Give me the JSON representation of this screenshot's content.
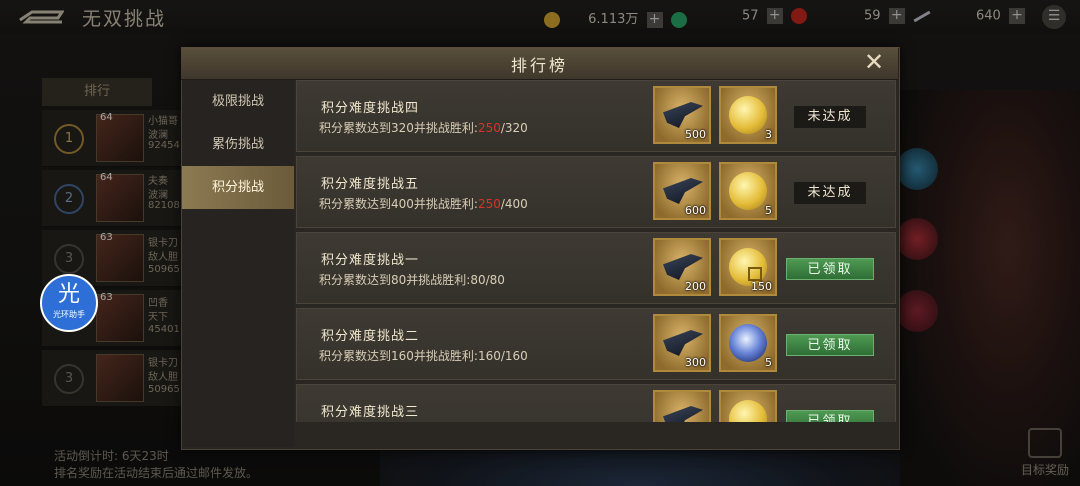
{
  "header": {
    "title": "无双挑战",
    "resources": [
      {
        "value": "6.113万",
        "icon": "gold-coin-icon"
      },
      {
        "value": "57",
        "icon": "jade-icon"
      },
      {
        "value": "59",
        "icon": "red-orb-icon"
      },
      {
        "value": "640",
        "icon": "quill-icon"
      }
    ]
  },
  "background": {
    "ranking_tab": "排行",
    "rows": [
      {
        "rank": "1",
        "level": "64",
        "line1": "小猫哥",
        "line2": "波澜",
        "line3": "92454"
      },
      {
        "rank": "2",
        "level": "64",
        "line1": "夫奏",
        "line2": "波澜",
        "line3": "82108"
      },
      {
        "rank": "3",
        "level": "63",
        "line1": "银卡刀",
        "line2": "敌人胆",
        "line3": "50965"
      },
      {
        "rank": "",
        "level": "63",
        "line1": "凹香",
        "line2": "天下",
        "line3": "45401"
      },
      {
        "rank": "3",
        "level": "",
        "line1": "银卡刀",
        "line2": "敌人胆",
        "line3": "50965"
      }
    ],
    "countdown": "活动倒计时: 6天23时",
    "notice": "排名奖励在活动结束后通过邮件发放。",
    "goal_reward": "目标奖励",
    "logo_text": "光",
    "logo_sub": "光环助手"
  },
  "modal": {
    "title": "排行榜",
    "tabs": [
      "极限挑战",
      "累伤挑战",
      "积分挑战"
    ],
    "active_tab": 2,
    "rows": [
      {
        "title": "积分难度挑战四",
        "desc_a": "积分累数达到320并挑战胜利:",
        "progress_cur": "250",
        "progress_max": "/320",
        "cur_red": true,
        "rewards": [
          {
            "type": "blade",
            "count": "500"
          },
          {
            "type": "coin",
            "count": "3"
          }
        ],
        "status": "未达成",
        "claimed": false
      },
      {
        "title": "积分难度挑战五",
        "desc_a": "积分累数达到400并挑战胜利:",
        "progress_cur": "250",
        "progress_max": "/400",
        "cur_red": true,
        "rewards": [
          {
            "type": "blade",
            "count": "600"
          },
          {
            "type": "coin",
            "count": "5"
          }
        ],
        "status": "未达成",
        "claimed": false
      },
      {
        "title": "积分难度挑战一",
        "desc_a": "积分累数达到80并挑战胜利:",
        "progress_cur": "80",
        "progress_max": "/80",
        "cur_red": false,
        "rewards": [
          {
            "type": "blade",
            "count": "200"
          },
          {
            "type": "coin-sq",
            "count": "150"
          }
        ],
        "status": "已领取",
        "claimed": true
      },
      {
        "title": "积分难度挑战二",
        "desc_a": "积分累数达到160并挑战胜利:",
        "progress_cur": "160",
        "progress_max": "/160",
        "cur_red": false,
        "rewards": [
          {
            "type": "blade",
            "count": "300"
          },
          {
            "type": "orb",
            "count": "5"
          }
        ],
        "status": "已领取",
        "claimed": true
      },
      {
        "title": "积分难度挑战三",
        "desc_a": "",
        "progress_cur": "",
        "progress_max": "",
        "cur_red": false,
        "rewards": [
          {
            "type": "blade",
            "count": ""
          },
          {
            "type": "coin",
            "count": ""
          }
        ],
        "status": "已领取",
        "claimed": true
      }
    ]
  },
  "colors": {
    "accent": "#8c7a52",
    "progress_red": "#d8342a",
    "claimed_green": "#4e9a52"
  }
}
